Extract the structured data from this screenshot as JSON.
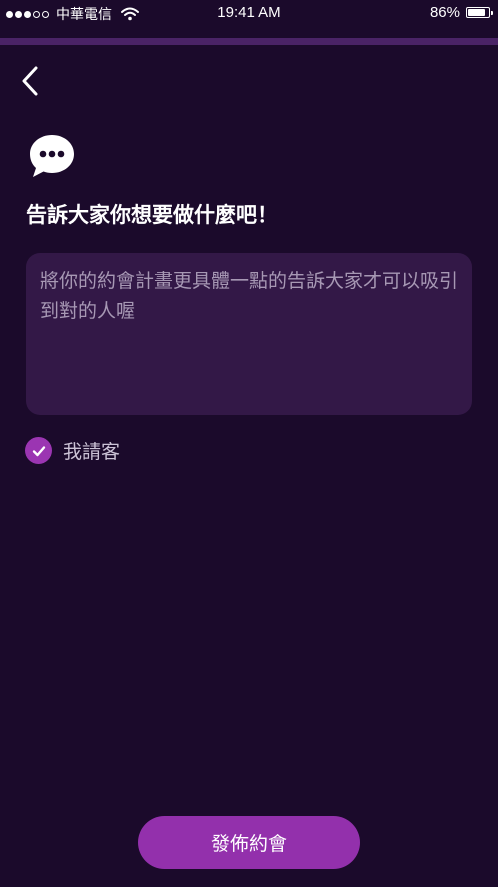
{
  "status_bar": {
    "carrier": "中華電信",
    "time": "19:41 AM",
    "battery_percent": "86%",
    "battery_level": 0.86,
    "signal_bars_filled": 3,
    "signal_bars_total": 5
  },
  "header": {
    "back_icon": "chevron-left-icon"
  },
  "content": {
    "icon": "chat-bubble-icon",
    "heading": "告訴大家你想要做什麼吧！",
    "textarea": {
      "value": "",
      "placeholder": "將你的約會計畫更具體一點的告訴大家才可以吸引到對的人喔"
    },
    "treat_option": {
      "label": "我請客",
      "checked": true
    }
  },
  "footer": {
    "publish_label": "發佈約會"
  },
  "colors": {
    "background": "#1b0a2b",
    "accent_bar": "#4a2366",
    "textarea_bg": "#331847",
    "accent": "#9330ac"
  }
}
